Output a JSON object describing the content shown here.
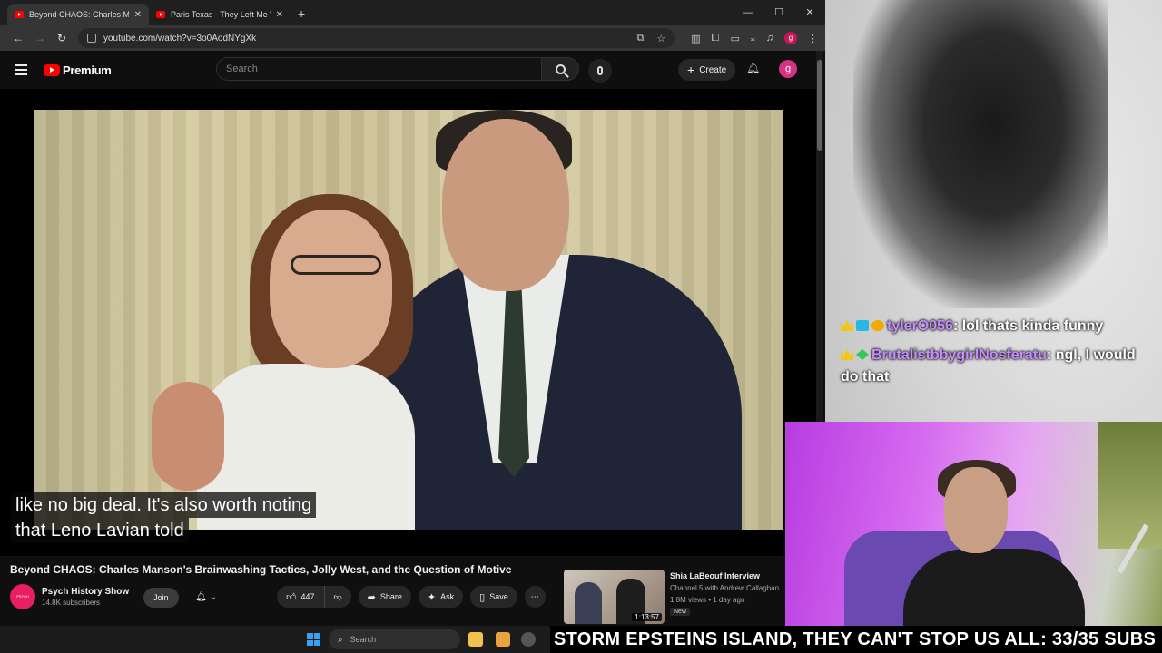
{
  "browser": {
    "tabs": [
      {
        "label": "Beyond CHAOS: Charles Manso",
        "active": true
      },
      {
        "label": "Paris Texas - They Left Me With",
        "active": false
      }
    ],
    "new_tab_icon": "plus-icon",
    "window_controls": {
      "minimize": "—",
      "maximize": "☐",
      "close": "✕"
    },
    "url": "youtube.com/watch?v=3o0AodNYgXk"
  },
  "youtube": {
    "logo_text": "Premium",
    "search_placeholder": "Search",
    "create_label": "Create",
    "avatar_letter": "g",
    "caption_lines": [
      "like no big deal. It's also worth noting",
      "that Leno Lavian told"
    ],
    "video_title": "Beyond CHAOS: Charles Manson's Brainwashing Tactics, Jolly West, and the Question of Motive",
    "channel_name": "Psych History Show",
    "channel_subs": "14.8K subscribers",
    "channel_avatar_text": "PSYCH HISTORY SHOW",
    "join_label": "Join",
    "like_count": "447",
    "share_label": "Share",
    "ask_label": "Ask",
    "save_label": "Save",
    "recommendation": {
      "title": "Shia LaBeouf Interview",
      "channel": "Channel 5 with Andrew Callaghan",
      "meta": "1.8M views • 1 day ago",
      "badge": "New",
      "duration": "1:13:57"
    }
  },
  "taskbar": {
    "search_placeholder": "Search"
  },
  "stream": {
    "chat": [
      {
        "user": "tylerO056",
        "message": "lol thats kinda funny"
      },
      {
        "user": "BrutalistbbygirlNosferatu",
        "message": "ngl, I would do that"
      }
    ],
    "ticker": "STORM EPSTEINS ISLAND, THEY CAN'T STOP US ALL: 33/35 SUBS"
  },
  "colors": {
    "youtube_red": "#ff0000",
    "chat_username": "#c58cff",
    "avatar_pink": "#d63384"
  }
}
